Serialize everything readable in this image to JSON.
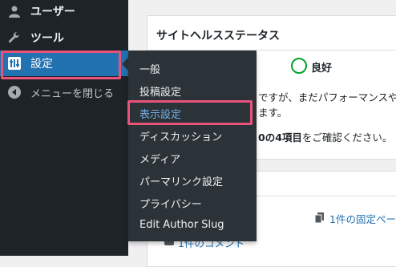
{
  "sidebar": {
    "items": [
      {
        "label": "ユーザー",
        "icon": "user-icon"
      },
      {
        "label": "ツール",
        "icon": "wrench-icon"
      },
      {
        "label": "設定",
        "icon": "settings-icon"
      },
      {
        "label": "メニューを閉じる",
        "icon": "collapse-icon"
      }
    ]
  },
  "flyout": {
    "items": [
      "一般",
      "投稿設定",
      "表示設定",
      "ディスカッション",
      "メディア",
      "パーマリンク設定",
      "プライバシー",
      "Edit Author Slug"
    ],
    "active_index": 2
  },
  "site_health": {
    "title": "サイトヘルスステータス",
    "status": "良好",
    "line1": "ですが、まだパフォーマンスや",
    "line2": "ます。",
    "line3_bold": "0の4項目",
    "line3_rest": "をご確認ください。"
  },
  "at_a_glance": {
    "pages_link": "1件の固定ペー",
    "comments_link": "1件のコメント"
  },
  "colors": {
    "sidebar_bg": "#1d2327",
    "current_bg": "#2271b1",
    "flyout_bg": "#2c3338",
    "highlight": "#e9537a",
    "link": "#2271b1",
    "good": "#00a32a"
  }
}
